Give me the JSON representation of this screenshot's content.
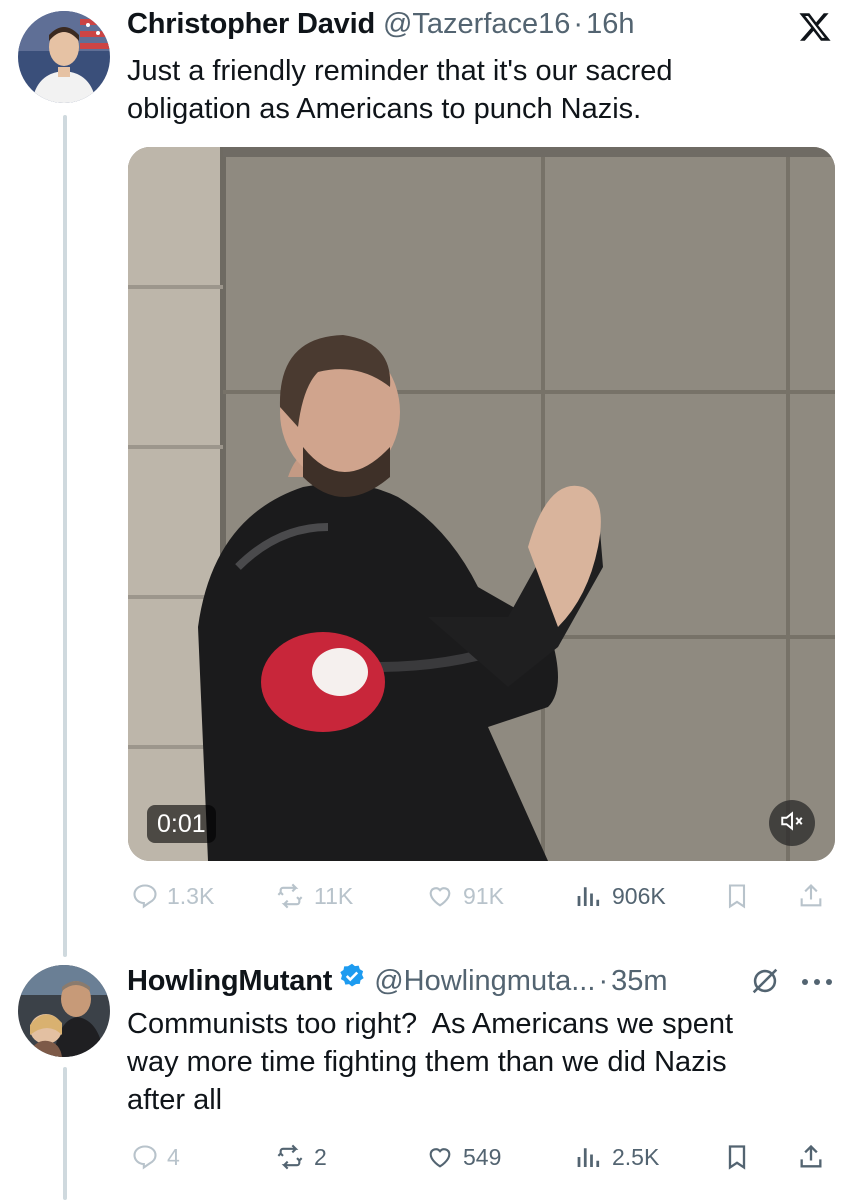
{
  "tweet1": {
    "display_name": "Christopher David",
    "handle": "@Tazerface16",
    "separator": "·",
    "time": "16h",
    "text_line1": "Just a friendly reminder that it's our sacred",
    "text_line2": "obligation as Americans to punch Nazis.",
    "video": {
      "duration": "0:01"
    },
    "stats": {
      "replies": "1.3K",
      "retweets": "11K",
      "likes": "91K",
      "views": "906K"
    }
  },
  "tweet2": {
    "display_name": "HowlingMutant",
    "handle": "@Howlingmuta...",
    "separator": "·",
    "time": "35m",
    "text_line1": "Communists too right?  As Americans we spent",
    "text_line2": "way more time fighting them than we did Nazis",
    "text_line3": "after all",
    "stats": {
      "replies": "4",
      "retweets": "2",
      "likes": "549",
      "views": "2.5K"
    }
  },
  "colors": {
    "text": "#0f1419",
    "secondary": "#536471",
    "verified": "#1d9bf0",
    "thread_line": "#cfd9de"
  }
}
